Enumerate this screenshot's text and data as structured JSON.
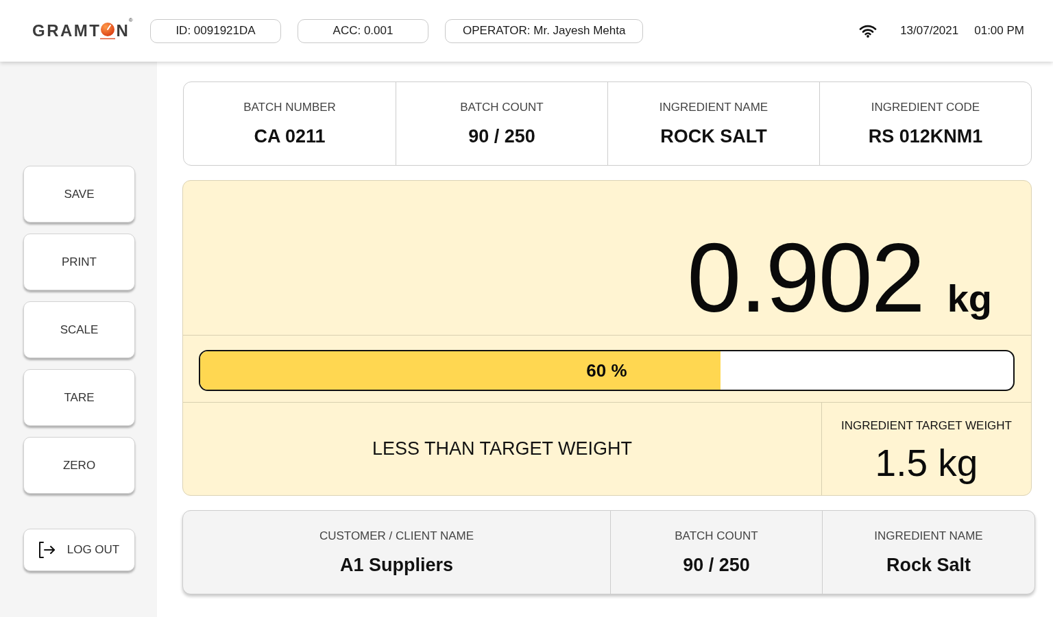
{
  "header": {
    "logo": {
      "before": "GRAMT",
      "after": "N",
      "mark": "®"
    },
    "chips": [
      "ID: 0091921DA",
      "ACC: 0.001",
      "OPERATOR: Mr. Jayesh Mehta"
    ],
    "date": "13/07/2021",
    "time": "01:00 PM"
  },
  "sidebar": {
    "buttons": [
      {
        "label": "SAVE"
      },
      {
        "label": "PRINT"
      },
      {
        "label": "SCALE"
      },
      {
        "label": "TARE"
      },
      {
        "label": "ZERO"
      }
    ],
    "logout": {
      "label": "LOG OUT"
    }
  },
  "batch_info": {
    "fields": [
      {
        "label": "BATCH NUMBER",
        "value": "CA 0211"
      },
      {
        "label": "BATCH COUNT",
        "value": "90 / 250"
      },
      {
        "label": "INGREDIENT NAME",
        "value": "ROCK SALT"
      },
      {
        "label": "INGREDIENT CODE",
        "value": "RS 012KNM1"
      }
    ]
  },
  "weighing": {
    "reading": "0.902",
    "unit": "kg",
    "progress": {
      "level": 0.64,
      "label": "60 %"
    },
    "status": "LESS THAN TARGET WEIGHT",
    "target": {
      "label": "INGREDIENT TARGET WEIGHT",
      "value": "1.5 kg"
    }
  },
  "summary": {
    "fields": [
      {
        "label": "CUSTOMER / CLIENT NAME",
        "value": "A1 Suppliers"
      },
      {
        "label": "BATCH COUNT",
        "value": "90 / 250"
      },
      {
        "label": "INGREDIENT NAME",
        "value": "Rock Salt"
      }
    ]
  }
}
